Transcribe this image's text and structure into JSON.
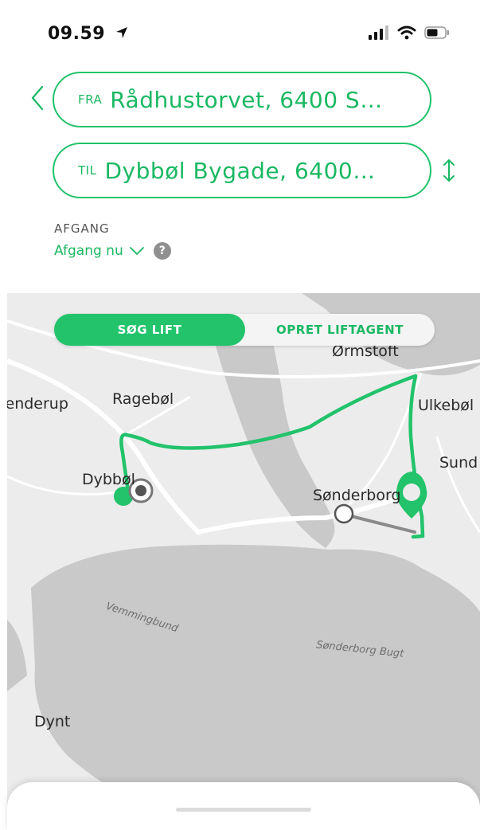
{
  "status_bar": {
    "time": "09.59"
  },
  "route": {
    "from_tag": "FRA",
    "from_value": "Rådhustorvet, 6400 S…",
    "to_tag": "TIL",
    "to_value": "Dybbøl Bygade, 6400…"
  },
  "departure": {
    "label": "AFGANG",
    "value": "Afgang nu"
  },
  "mode_toggle": {
    "active": "SØG LIFT",
    "inactive": "OPRET LIFTAGENT"
  },
  "map": {
    "places": {
      "ormstoft": "Ørmstoft",
      "stenderup": "Stenderup",
      "ragebol": "Ragebøl",
      "ulkebol": "Ulkebøl",
      "sund": "Sund",
      "dybbol": "Dybbøl",
      "sonderborg": "Sønderborg",
      "dynt": "Dynt"
    },
    "water": {
      "vemmingbund": "Vemmingbund",
      "sonderborg_bugt": "Sønderborg Bugt"
    }
  },
  "colors": {
    "accent": "#22c36b",
    "route_gray": "#8a8a8a",
    "water": "#c9c9c9",
    "land": "#ececec"
  }
}
